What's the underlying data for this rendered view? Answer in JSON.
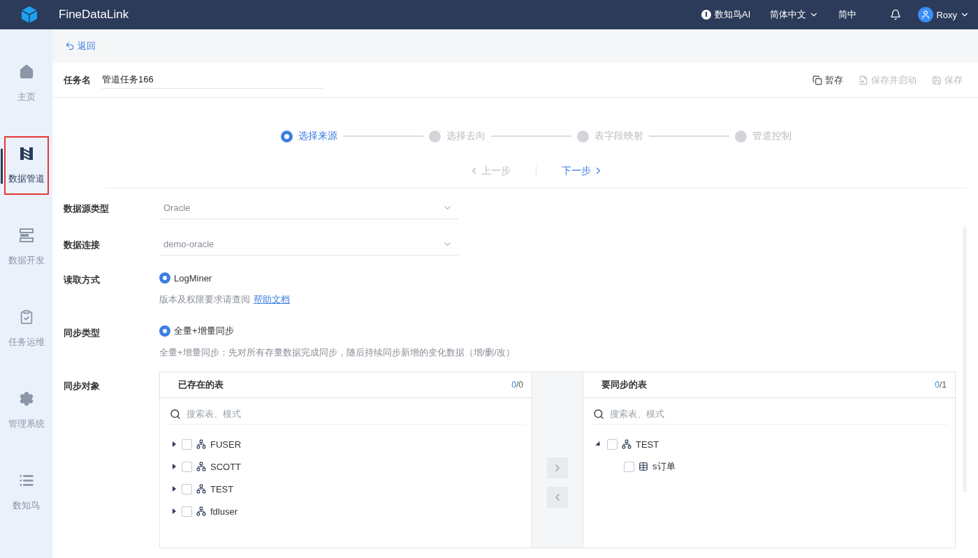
{
  "header": {
    "brand": "FineDataLink",
    "ai_label": "数知鸟AI",
    "language": "简体中文",
    "short_language": "简中",
    "user": "Roxy"
  },
  "sidebar": {
    "items": [
      {
        "label": "主页",
        "kind": "home",
        "selected": false
      },
      {
        "label": "数据管道",
        "kind": "pipeline",
        "selected": true
      },
      {
        "label": "数据开发",
        "kind": "develop",
        "selected": false
      },
      {
        "label": "任务运维",
        "kind": "ops",
        "selected": false
      },
      {
        "label": "管理系统",
        "kind": "settings",
        "selected": false
      },
      {
        "label": "数知鸟",
        "kind": "list",
        "selected": false
      }
    ]
  },
  "back_link": "返回",
  "task": {
    "label": "任务名",
    "value": "管道任务166"
  },
  "actions": [
    {
      "label": "暂存",
      "kind": "draft",
      "disabled": false
    },
    {
      "label": "保存并启动",
      "kind": "start",
      "disabled": true
    },
    {
      "label": "保存",
      "kind": "save",
      "disabled": true
    }
  ],
  "steps": [
    {
      "label": "选择来源",
      "selected": true
    },
    {
      "label": "选择去向",
      "selected": false
    },
    {
      "label": "表字段映射",
      "selected": false
    },
    {
      "label": "管道控制",
      "selected": false
    }
  ],
  "nav": {
    "prev": {
      "label": "上一步",
      "disabled": true
    },
    "next": {
      "label": "下一步",
      "disabled": false
    }
  },
  "form": [
    {
      "kind": "select",
      "label": "数据源类型",
      "value": "Oracle"
    },
    {
      "kind": "select",
      "label": "数据连接",
      "value": "demo-oracle"
    },
    {
      "kind": "radio",
      "label": "读取方式",
      "option": "LogMiner",
      "selected": true,
      "hint": "版本及权限要求请查阅",
      "link": "帮助文档"
    },
    {
      "kind": "radio",
      "label": "同步类型",
      "option": "全量+增量同步",
      "selected": true,
      "hint": "全量+增量同步：先对所有存量数据完成同步，随后持续同步新增的变化数据（增/删/改）"
    }
  ],
  "sync_objects": {
    "label": "同步对象",
    "source": {
      "title": "已存在的表",
      "count_selected": "0",
      "count_rest": "/0",
      "placeholder": "搜索表、模式",
      "items": [
        {
          "name": "FUSER",
          "kind": "schema",
          "checked": false,
          "expanded": false
        },
        {
          "name": "SCOTT",
          "kind": "schema",
          "checked": false,
          "expanded": false
        },
        {
          "name": "TEST",
          "kind": "schema",
          "checked": false,
          "expanded": false
        },
        {
          "name": "fdluser",
          "kind": "schema",
          "checked": false,
          "expanded": false
        }
      ]
    },
    "target": {
      "title": "要同步的表",
      "count_selected": "0",
      "count_rest": "/1",
      "placeholder": "搜索表、模式",
      "items": [
        {
          "name": "TEST",
          "kind": "schema",
          "checked": false,
          "expanded": true,
          "children": [
            {
              "name": "s订单",
              "kind": "table",
              "checked": false
            }
          ]
        }
      ]
    }
  }
}
